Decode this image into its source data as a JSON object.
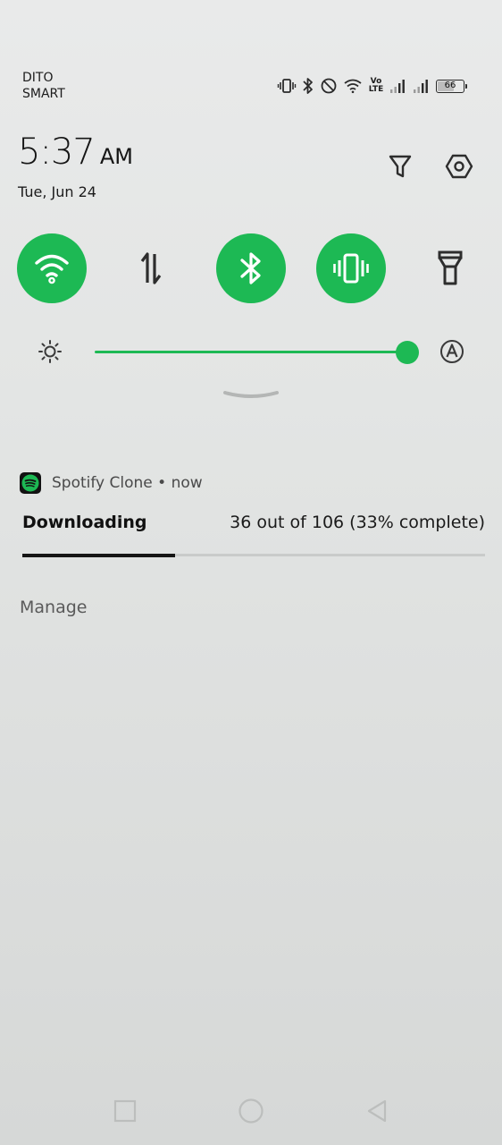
{
  "status_bar": {
    "carrier_line1": "DITO",
    "carrier_line2": "SMART",
    "volte_top": "Vo",
    "volte_bottom": "LTE",
    "battery_level": "66",
    "battery_fraction": 0.66,
    "icons": [
      "vibrate-icon",
      "bluetooth-icon",
      "do-not-disturb-icon",
      "wifi-icon",
      "volte-icon",
      "signal-icon",
      "signal-icon",
      "battery-icon"
    ]
  },
  "header": {
    "time": "5:37",
    "ampm": "AM",
    "date": "Tue, Jun 24",
    "icons": [
      "filter-icon",
      "settings-icon"
    ]
  },
  "quick_tiles": [
    {
      "name": "wifi",
      "icon": "wifi-icon",
      "active": true
    },
    {
      "name": "mobile-data",
      "icon": "data-arrows-icon",
      "active": false
    },
    {
      "name": "bluetooth",
      "icon": "bluetooth-icon",
      "active": true
    },
    {
      "name": "vibrate",
      "icon": "vibrate-icon",
      "active": true
    },
    {
      "name": "flashlight",
      "icon": "flashlight-icon",
      "active": false
    }
  ],
  "brightness": {
    "level": 1.0,
    "icons": [
      "brightness-icon",
      "auto-brightness-icon"
    ]
  },
  "notification": {
    "app_name": "Spotify Clone",
    "separator": "•",
    "time": "now",
    "title": "Downloading",
    "progress_text": "36 out of 106 (33% complete)",
    "progress_fraction": 0.33,
    "action": "Manage"
  },
  "nav_bar": {
    "icons": [
      "recents-square-icon",
      "home-circle-icon",
      "back-triangle-icon"
    ]
  },
  "colors": {
    "accent": "#1db954",
    "background": "#e5e7e6",
    "text": "#1c1c1c"
  }
}
